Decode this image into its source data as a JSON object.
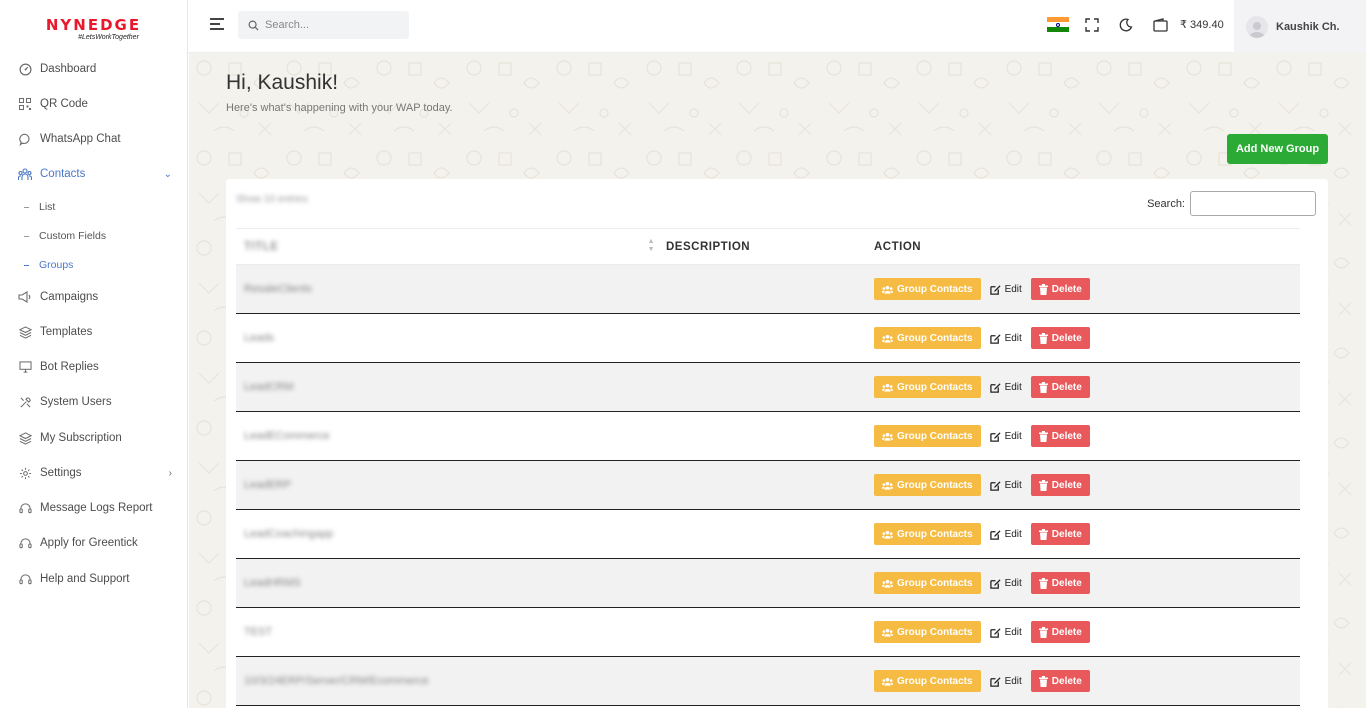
{
  "brand": {
    "name": "nynedge",
    "tagline": "#LetsWorkTogether",
    "color": "#e8192c"
  },
  "sidebar": {
    "items": [
      {
        "label": "Dashboard",
        "icon": "dashboard-icon"
      },
      {
        "label": "QR Code",
        "icon": "qr-code-icon"
      },
      {
        "label": "WhatsApp Chat",
        "icon": "chat-bubble-icon"
      },
      {
        "label": "Contacts",
        "icon": "contacts-icon",
        "active": true,
        "expanded": true,
        "children": [
          {
            "label": "List"
          },
          {
            "label": "Custom Fields"
          },
          {
            "label": "Groups",
            "active": true
          }
        ]
      },
      {
        "label": "Campaigns",
        "icon": "megaphone-icon"
      },
      {
        "label": "Templates",
        "icon": "layers-icon"
      },
      {
        "label": "Bot Replies",
        "icon": "monitor-icon"
      },
      {
        "label": "System Users",
        "icon": "tools-icon"
      },
      {
        "label": "My Subscription",
        "icon": "layers-icon"
      },
      {
        "label": "Settings",
        "icon": "settings-icon",
        "has_submenu": true
      },
      {
        "label": "Message Logs Report",
        "icon": "headset-icon"
      },
      {
        "label": "Apply for Greentick",
        "icon": "headset-icon"
      },
      {
        "label": "Help and Support",
        "icon": "headset-icon"
      }
    ]
  },
  "topbar": {
    "search_placeholder": "Search...",
    "balance": "₹ 349.40",
    "user_name": "Kaushik Ch."
  },
  "main": {
    "greeting": "Hi, Kaushik!",
    "subtitle": "Here's what's happening with your WAP today.",
    "add_button": "Add New Group",
    "add_button_color": "#2bab35"
  },
  "table": {
    "show_entries": "Show 10 entries",
    "search_label": "Search:",
    "headers": {
      "title": "TITLE",
      "description": "DESCRIPTION",
      "action": "ACTION"
    },
    "rows": [
      {
        "title": "ResaleClients",
        "description": ""
      },
      {
        "title": "Leads",
        "description": ""
      },
      {
        "title": "LeadCRM",
        "description": ""
      },
      {
        "title": "LeadECommerce",
        "description": ""
      },
      {
        "title": "LeadERP",
        "description": ""
      },
      {
        "title": "LeadCoachingapp",
        "description": ""
      },
      {
        "title": "LeadHRMS",
        "description": ""
      },
      {
        "title": "TEST",
        "description": ""
      },
      {
        "title": "10/3/24ERP/Server/CRM/Ecommerce",
        "description": ""
      }
    ],
    "actions": {
      "group_contacts": "Group Contacts",
      "edit": "Edit",
      "delete": "Delete"
    },
    "colors": {
      "group_contacts": "#f6bb42",
      "delete": "#e9595b"
    }
  }
}
